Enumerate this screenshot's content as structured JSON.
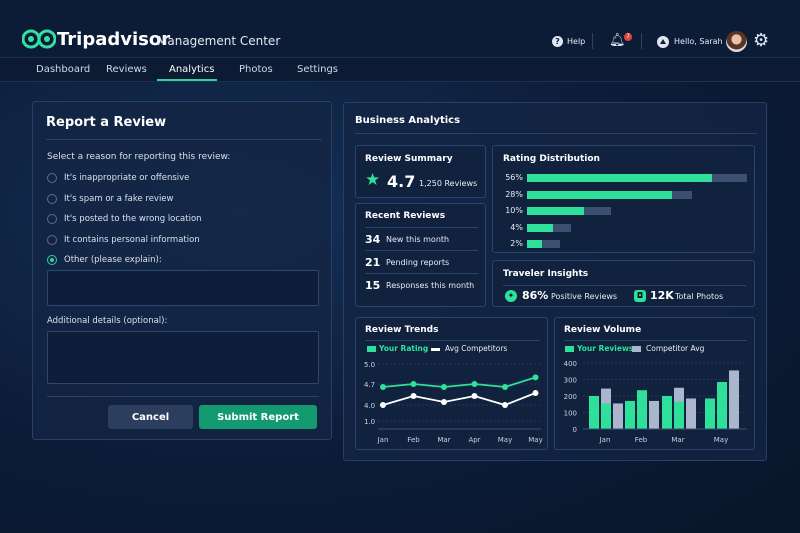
{
  "header": {
    "brand": "Tripadvisor",
    "title": "Management Center",
    "help": "Help",
    "notification_count": "7",
    "greeting": "Hello, Sarah",
    "icons": [
      "owl-logo-icon",
      "help-icon",
      "bell-icon",
      "user-icon",
      "avatar",
      "gear-icon"
    ]
  },
  "nav": {
    "tabs": [
      "Dashboard",
      "Reviews",
      "Analytics",
      "Photos",
      "Settings"
    ],
    "active": "Analytics"
  },
  "report": {
    "title": "Report a Review",
    "prompt": "Select a reason for reporting this review:",
    "reasons": [
      "It's inappropriate or offensive",
      "It's spam or a fake review",
      "It's posted to the wrong location",
      "It contains personal information",
      "Other (please explain):"
    ],
    "selected_index": 4,
    "other_value": "",
    "details_label": "Additional details (optional):",
    "details_value": "",
    "cancel": "Cancel",
    "submit": "Submit Report"
  },
  "analytics": {
    "title": "Business Analytics",
    "summary": {
      "title": "Review Summary",
      "rating": "4.7",
      "count": "1,250 Reviews"
    },
    "recent": {
      "title": "Recent Reviews",
      "items": [
        {
          "num": "34",
          "label": "New this month"
        },
        {
          "num": "21",
          "label": "Pending reports"
        },
        {
          "num": "15",
          "label": "Responses this month"
        }
      ]
    },
    "distribution": {
      "title": "Rating Distribution",
      "rows": [
        {
          "label": "56%",
          "fill": 84,
          "total": 100
        },
        {
          "label": "28%",
          "fill": 66,
          "total": 75
        },
        {
          "label": "10%",
          "fill": 26,
          "total": 38
        },
        {
          "label": "4%",
          "fill": 12,
          "total": 20
        },
        {
          "label": "2%",
          "fill": 7,
          "total": 15
        }
      ]
    },
    "insights": {
      "title": "Traveler Insights",
      "positive_value": "86%",
      "positive_label": "Positive Reviews",
      "photos_value": "12K",
      "photos_label": "Total Photos"
    }
  },
  "colors": {
    "accent": "#2ee09a",
    "competitor": "#a9b6cc",
    "bg": "#0c1c38"
  },
  "chart_data": [
    {
      "type": "line",
      "title": "Review Trends",
      "categories": [
        "Jan",
        "Feb",
        "Mar",
        "Apr",
        "May",
        "May"
      ],
      "yticks": [
        5.0,
        4.7,
        4.0,
        1.0
      ],
      "ytick_labels": [
        "5.0",
        "4.7",
        "4.0",
        "1.0"
      ],
      "series": [
        {
          "name": "Your Rating",
          "color": "#2ee09a",
          "values": [
            4.6,
            4.7,
            4.6,
            4.7,
            4.6,
            4.8
          ]
        },
        {
          "name": "Avg Competitors",
          "color": "#ffffff",
          "values": [
            4.0,
            4.3,
            4.1,
            4.3,
            4.0,
            4.4
          ]
        }
      ],
      "grid": true,
      "legend": "top-left"
    },
    {
      "type": "bar",
      "title": "Review Volume",
      "categories": [
        "Jan",
        "Feb",
        "Mar",
        "May"
      ],
      "ylim": [
        0,
        400
      ],
      "yticks": [
        "400",
        "300",
        "200",
        "100",
        "0"
      ],
      "series": [
        {
          "name": "Your Reviews",
          "color": "#2ee09a"
        },
        {
          "name": "Competitor Avg",
          "color": "#a9b6cc"
        }
      ],
      "groups": [
        {
          "bars": [
            {
              "your": 200,
              "comp": 0
            },
            {
              "your": 155,
              "comp": 245
            },
            {
              "your": 0,
              "comp": 155
            }
          ]
        },
        {
          "bars": [
            {
              "your": 170,
              "comp": 0
            },
            {
              "your": 235,
              "comp": 0
            },
            {
              "your": 0,
              "comp": 170
            }
          ]
        },
        {
          "bars": [
            {
              "your": 200,
              "comp": 0
            },
            {
              "your": 165,
              "comp": 250
            },
            {
              "your": 0,
              "comp": 185
            }
          ]
        },
        {
          "bars": [
            {
              "your": 185,
              "comp": 0
            },
            {
              "your": 285,
              "comp": 0
            },
            {
              "your": 0,
              "comp": 355
            }
          ]
        }
      ],
      "grid": true,
      "legend": "top-left"
    }
  ]
}
